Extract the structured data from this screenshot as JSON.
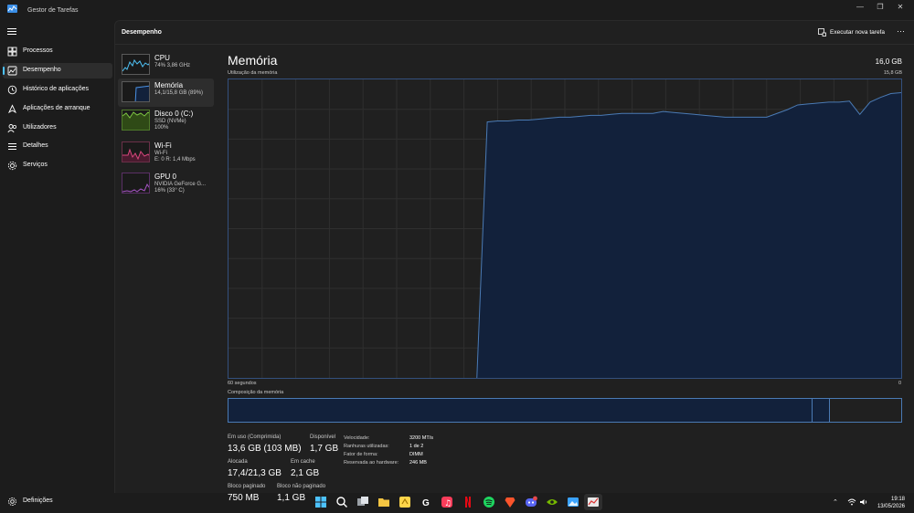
{
  "window": {
    "title": "Gestor de Tarefas"
  },
  "nav": {
    "items": [
      {
        "label": "Processos"
      },
      {
        "label": "Desempenho"
      },
      {
        "label": "Histórico de aplicações"
      },
      {
        "label": "Aplicações de arranque"
      },
      {
        "label": "Utilizadores"
      },
      {
        "label": "Detalhes"
      },
      {
        "label": "Serviços"
      }
    ],
    "settings": "Definições"
  },
  "header": {
    "title": "Desempenho",
    "run_task": "Executar nova tarefa",
    "more": "···"
  },
  "resources": [
    {
      "name": "CPU",
      "lines": [
        "74% 3,86 GHz"
      ],
      "color": "#4fc3f7"
    },
    {
      "name": "Memória",
      "lines": [
        "14,1/15,8 GB (89%)"
      ],
      "color": "#4a90e2"
    },
    {
      "name": "Disco 0 (C:)",
      "lines": [
        "SSD (NVMe)",
        "100%"
      ],
      "color": "#7cc242"
    },
    {
      "name": "Wi-Fi",
      "lines": [
        "Wi-Fi",
        "E: 0 R: 1,4 Mbps"
      ],
      "color": "#d9477d"
    },
    {
      "name": "GPU 0",
      "lines": [
        "NVIDIA GeForce G...",
        "16% (33° C)"
      ],
      "color": "#a855c7"
    }
  ],
  "detail": {
    "title": "Memória",
    "total": "16,0 GB",
    "usage_label": "Utilização da memória",
    "usage_max": "15,8 GB",
    "time_left": "60 segundos",
    "time_right": "0",
    "composition_label": "Composição da memória",
    "usage_history_gb": [
      0,
      0,
      0,
      0,
      0,
      0,
      0,
      0,
      0,
      0,
      0,
      0,
      0,
      0,
      0,
      0,
      0,
      0,
      0,
      0,
      0,
      0,
      0,
      0,
      0,
      13.55,
      13.6,
      13.6,
      13.65,
      13.65,
      13.7,
      13.75,
      13.8,
      13.8,
      13.85,
      13.9,
      13.9,
      13.95,
      14.0,
      14.0,
      14.0,
      14.0,
      14.1,
      14.05,
      14.0,
      13.95,
      13.9,
      13.85,
      13.8,
      13.8,
      13.8,
      13.8,
      13.8,
      14.0,
      14.2,
      14.45,
      14.5,
      14.55,
      14.6,
      14.6,
      14.65,
      13.95,
      14.6,
      14.85,
      15.05,
      15.1
    ],
    "stats": [
      {
        "label": "Em uso (Comprimida)",
        "value": "13,6 GB (103 MB)"
      },
      {
        "label": "Disponível",
        "value": "1,7 GB"
      },
      {
        "label": "Alocada",
        "value": "17,4/21,3 GB"
      },
      {
        "label": "Em cache",
        "value": "2,1 GB"
      },
      {
        "label": "Bloco paginado",
        "value": "750 MB"
      },
      {
        "label": "Bloco não paginado",
        "value": "1,1 GB"
      }
    ],
    "kv": [
      {
        "k": "Velocidade:",
        "v": "3200 MT/s"
      },
      {
        "k": "Ranhuras utilizadas:",
        "v": "1 de 2"
      },
      {
        "k": "Fator de forma:",
        "v": "DIMM"
      },
      {
        "k": "Reservada ao hardware:",
        "v": "246 MB"
      }
    ]
  },
  "taskbar": {
    "icons": [
      "windows-start",
      "search",
      "task-view",
      "file-explorer",
      "sticky-notes",
      "app-g",
      "apple-music",
      "netflix",
      "spotify",
      "brave",
      "discord",
      "nvidia",
      "photos",
      "task-manager"
    ],
    "clock_time": "19:18",
    "clock_date": "13/05/2026"
  },
  "colors": {
    "accent": "#4cc2ff",
    "memory": "#4a7ab4",
    "memory_fill": "#12213b"
  }
}
